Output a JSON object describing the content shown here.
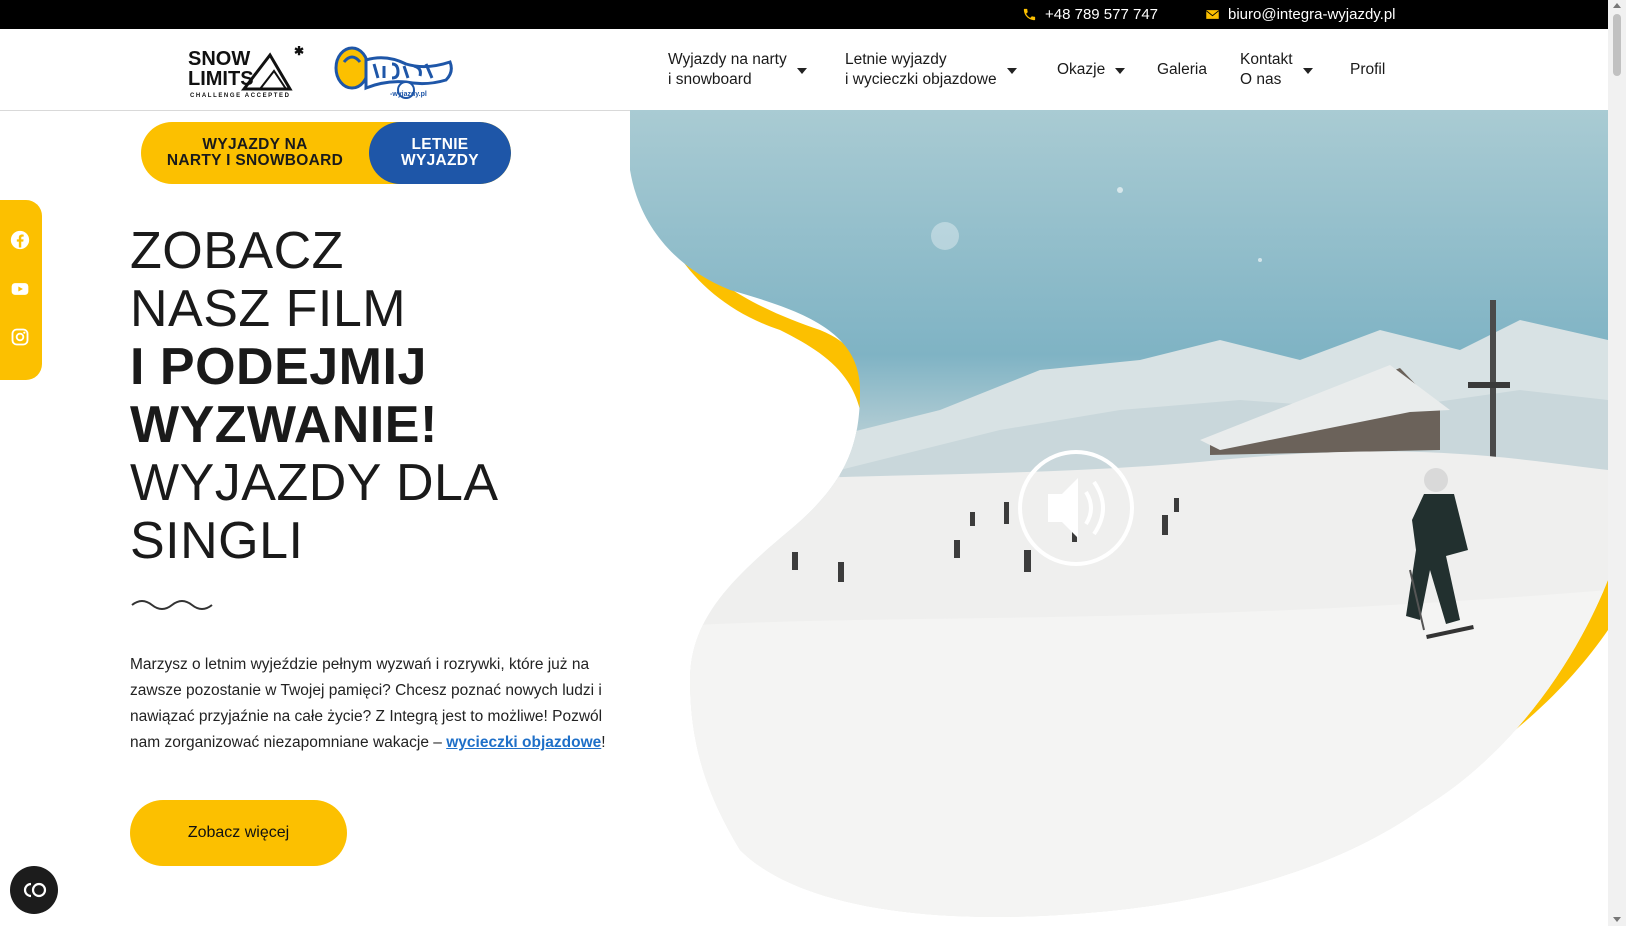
{
  "topbar": {
    "phone": "+48 789 577 747",
    "email": "biuro@integra-wyjazdy.pl"
  },
  "logos": {
    "snow_line1": "SNOW",
    "snow_line2": "LIMITS",
    "snow_tagline": "CHALLENGE ACCEPTED",
    "integra_small": "-wyjazdy.pl"
  },
  "nav": {
    "items": [
      {
        "line1": "Wyjazdy na narty",
        "line2": "i snowboard",
        "dropdown": true
      },
      {
        "line1": "Letnie wyjazdy",
        "line2": "i wycieczki objazdowe",
        "dropdown": true
      },
      {
        "line1": "Okazje",
        "line2": "",
        "dropdown": true
      },
      {
        "line1": "Galeria",
        "line2": "",
        "dropdown": false
      },
      {
        "line1": "Kontakt",
        "line2": "O nas",
        "dropdown": true
      },
      {
        "line1": "Profil",
        "line2": "",
        "dropdown": false
      }
    ]
  },
  "toggle": {
    "option_a_line1": "WYJAZDY NA",
    "option_a_line2": "NARTY I SNOWBOARD",
    "option_b_line1": "LETNIE",
    "option_b_line2": "WYJAZDY",
    "active": "option_b"
  },
  "headline": {
    "line1": "ZOBACZ",
    "line2": "NASZ FILM",
    "line3": "I PODEJMIJ",
    "line4": "WYZWANIE!",
    "line5": "WYJAZDY DLA",
    "line6": "SINGLI"
  },
  "description": {
    "text": "Marzysz o letnim wyjeździe pełnym wyzwań i rozrywki, które już na zawsze pozostanie w Twojej pamięci? Chcesz poznać nowych ludzi i nawiązać przyjaźnie na całe życie? Z Integrą jest to możliwe! Pozwól nam zorganizować niezapomniane wakacje – ",
    "link_text": "wycieczki objazdowe",
    "suffix": "!"
  },
  "cta": {
    "label": "Zobacz więcej"
  },
  "social": [
    "facebook-icon",
    "youtube-icon",
    "instagram-icon"
  ],
  "colors": {
    "accent_yellow": "#fcc000",
    "accent_blue": "#1e56a8",
    "link_blue": "#1e6fc8",
    "topbar_bg": "#000000"
  }
}
